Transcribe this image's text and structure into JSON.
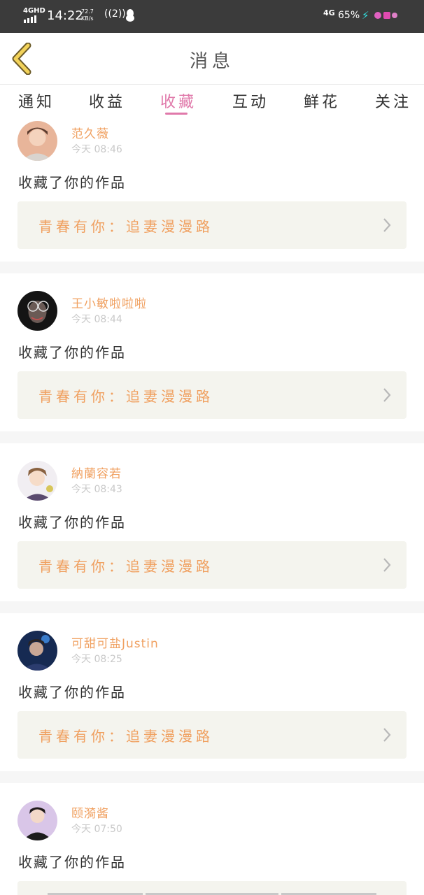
{
  "status_bar": {
    "network": "4GHD",
    "time": "14:22",
    "speed": "72.7\nKB/s",
    "hotspot": "((2))",
    "mobile": "4G",
    "battery": "65%"
  },
  "header": {
    "title": "消息",
    "back_icon": "chevron-left-icon"
  },
  "tabs": [
    {
      "label": "通知"
    },
    {
      "label": "收益"
    },
    {
      "label": "收藏",
      "active": true
    },
    {
      "label": "互动"
    },
    {
      "label": "鲜花"
    },
    {
      "label": "关注"
    }
  ],
  "colors": {
    "accent": "#e079aa",
    "name": "#f0a060",
    "time": "#c9c9c9",
    "card_bg": "#f4f4ee"
  },
  "feed": [
    {
      "user": "范久薇",
      "time": "今天 08:46",
      "action": "收藏了你的作品",
      "work": "青春有你：追妻漫漫路"
    },
    {
      "user": "王小敏啦啦啦",
      "time": "今天 08:44",
      "action": "收藏了你的作品",
      "work": "青春有你：追妻漫漫路"
    },
    {
      "user": "納蘭容若",
      "time": "今天 08:43",
      "action": "收藏了你的作品",
      "work": "青春有你：追妻漫漫路"
    },
    {
      "user": "可甜可盐Justin",
      "time": "今天 08:25",
      "action": "收藏了你的作品",
      "work": "青春有你：追妻漫漫路"
    },
    {
      "user": "颐漪酱",
      "time": "今天 07:50",
      "action": "收藏了你的作品",
      "work": ""
    }
  ]
}
